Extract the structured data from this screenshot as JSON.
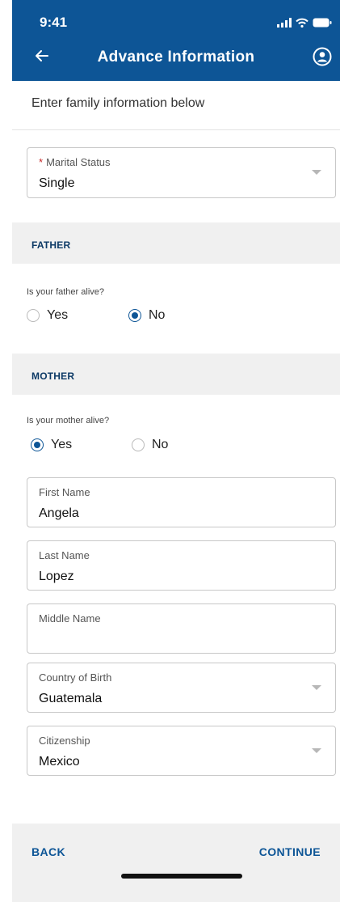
{
  "status_bar": {
    "time": "9:41",
    "icons": [
      "signal-icon",
      "wifi-icon",
      "battery-icon"
    ]
  },
  "header": {
    "title": "Advance Information",
    "back_icon": "back-arrow-icon",
    "profile_icon": "profile-icon"
  },
  "intro": {
    "text": "Enter family information below"
  },
  "marital_status": {
    "label": "Marital Status",
    "required": "*",
    "value": "Single"
  },
  "father": {
    "section_title": "FATHER",
    "question": "Is your father alive?",
    "options": [
      "Yes",
      "No"
    ],
    "selected": "No"
  },
  "mother": {
    "section_title": "MOTHER",
    "question": "Is your mother alive?",
    "options": [
      "Yes",
      "No"
    ],
    "selected": "Yes",
    "fields": {
      "first_name": {
        "label": "First Name",
        "value": "Angela"
      },
      "last_name": {
        "label": "Last Name",
        "value": "Lopez"
      },
      "middle_name": {
        "label": "Middle Name",
        "value": ""
      },
      "country_of_birth": {
        "label": "Country of Birth",
        "value": "Guatemala"
      },
      "citizenship": {
        "label": "Citizenship",
        "value": "Mexico"
      }
    }
  },
  "footer": {
    "back_label": "BACK",
    "continue_label": "CONTINUE"
  },
  "colors": {
    "brand_blue": "#0d5596",
    "section_title": "#0d3a66",
    "required": "#c62828",
    "band": "#f0f0f0"
  }
}
